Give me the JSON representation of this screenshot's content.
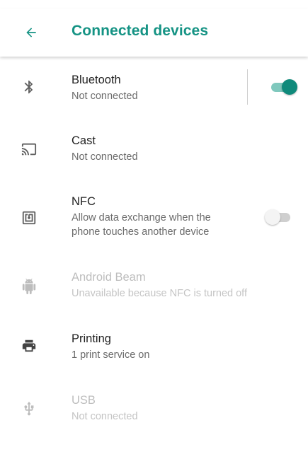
{
  "app_bar": {
    "back_icon": "arrow-back-icon",
    "title": "Connected devices",
    "accent_color": "#159384"
  },
  "items": [
    {
      "icon": "bluetooth-icon",
      "title": "Bluetooth",
      "subtitle": "Not connected",
      "toggle": "on",
      "enabled": true
    },
    {
      "icon": "cast-icon",
      "title": "Cast",
      "subtitle": "Not connected",
      "enabled": true
    },
    {
      "icon": "nfc-icon",
      "title": "NFC",
      "subtitle_line1": "Allow data exchange when the",
      "subtitle_line2": "phone touches another device",
      "toggle": "off",
      "enabled": true
    },
    {
      "icon": "android-icon",
      "title": "Android Beam",
      "subtitle": "Unavailable because NFC is turned off",
      "enabled": false
    },
    {
      "icon": "printer-icon",
      "title": "Printing",
      "subtitle": "1 print service on",
      "enabled": true
    },
    {
      "icon": "usb-icon",
      "title": "USB",
      "subtitle": "Not connected",
      "enabled": false
    }
  ]
}
